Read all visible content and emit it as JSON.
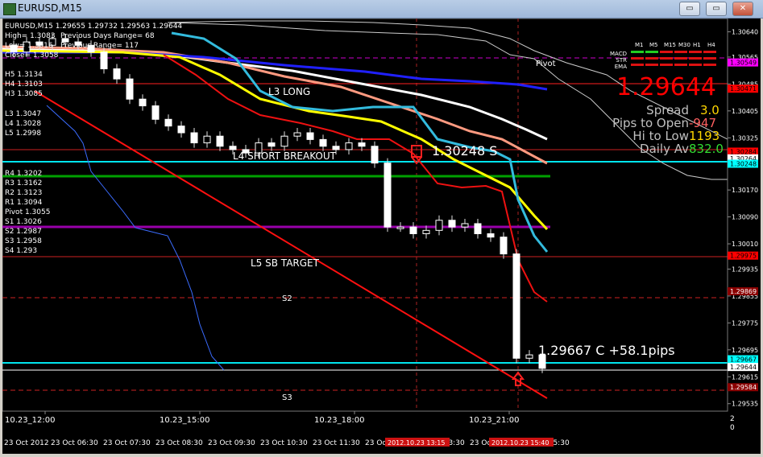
{
  "window": {
    "title": "EURUSD,M15",
    "buttons": {
      "minimize": "▭",
      "restore": "▭",
      "close": "✕"
    }
  },
  "header": {
    "ohlc": "EURUSD,M15  1.29655 1.29732 1.29563 1.29644",
    "high": "High= 1.3083",
    "low": "Low= 1.3016",
    "close": "Close= 1.3058",
    "prev_range": "Previous Days Range= 68",
    "prev_range2": "Previous Range= 117"
  },
  "levels_left_top": [
    "H5 1.3134",
    "H4 1.3103",
    "H3 1.3085"
  ],
  "levels_left_mid": [
    "L3 1.3047",
    "L4 1.3028",
    "L5 1.2998"
  ],
  "levels_left_bottom": [
    "R4 1.3202",
    "R3 1.3162",
    "R2 1.3123",
    "R1 1.3094",
    "Pivot 1.3055",
    "S1 1.3026",
    "S2 1.2987",
    "S3 1.2958",
    "S4 1.293"
  ],
  "chart_labels": {
    "l3_long": "L3 LONG",
    "l4_short": "L4 SHORT BREAKOUT",
    "l5_target": "L5 SB TARGET",
    "s2": "S2",
    "s3": "S3",
    "pivot": "Pivot",
    "signal": "1.30248 S",
    "close_result": "1.29667 C +58.1pips"
  },
  "info": {
    "price": "1.29644",
    "spread_label": "Spread",
    "spread_value": "3.0",
    "pips_open_label": "Pips to Open",
    "pips_open_value": "-947",
    "hilo_label": "Hi to Low",
    "hilo_value": "1193",
    "daily_label": "Daily Av",
    "daily_value": "832.0"
  },
  "mini_panel": {
    "tf_labels": [
      "M1",
      "M5",
      "M15",
      "M30",
      "H1",
      "H4"
    ],
    "rows": [
      "MACD",
      "STR",
      "EMA"
    ]
  },
  "price_axis": {
    "ticks": [
      "1.30640",
      "1.30565",
      "1.30485",
      "1.30405",
      "1.30325",
      "1.30250",
      "1.30170",
      "1.30090",
      "1.30010",
      "1.29935",
      "1.29855",
      "1.29775",
      "1.29695",
      "1.29615",
      "1.29535"
    ],
    "markers": [
      {
        "value": "1.30549",
        "color": "#ff00ff",
        "text": "#000000"
      },
      {
        "value": "1.30471",
        "color": "#ff0000",
        "text": "#000000"
      },
      {
        "value": "1.30284",
        "color": "#ff0000",
        "text": "#000000"
      },
      {
        "value": "1.30264",
        "color": "#ffffff",
        "text": "#000000"
      },
      {
        "value": "1.30248",
        "color": "#00ffff",
        "text": "#000000"
      },
      {
        "value": "1.29975",
        "color": "#ff0000",
        "text": "#000000"
      },
      {
        "value": "1.29869",
        "color": "#8b0000",
        "text": "#ffffff"
      },
      {
        "value": "1.29667",
        "color": "#00ffff",
        "text": "#000000"
      },
      {
        "value": "1.29644",
        "color": "#ffffff",
        "text": "#000000"
      },
      {
        "value": "1.29584",
        "color": "#8b0000",
        "text": "#ffffff"
      }
    ]
  },
  "time_axis_upper": [
    "10.23_12:00",
    "10.23_15:00",
    "10.23_18:00",
    "10.23_21:00"
  ],
  "time_axis_lower": [
    "23 Oct 2012",
    "23 Oct 06:30",
    "23 Oct 07:30",
    "23 Oct 08:30",
    "23 Oct 09:30",
    "23 Oct 10:30",
    "23 Oct 11:30",
    "23 Oct 12:30",
    "23 Oct 13:30",
    "23 Oct 14:30",
    "23 Oct 15:30"
  ],
  "time_markers": [
    "2012.10.23 13:15",
    "2012.10.23 15:40"
  ],
  "bottom_right": [
    "2",
    "0"
  ],
  "chart_data": {
    "type": "line",
    "title": "EURUSD,M15",
    "ylim": [
      1.2952,
      1.3067
    ],
    "grid": false,
    "candles_close": [
      1.3058,
      1.3061,
      1.306,
      1.3062,
      1.3061,
      1.306,
      1.3058,
      1.3053,
      1.305,
      1.3044,
      1.3042,
      1.3038,
      1.3036,
      1.3034,
      1.3031,
      1.3033,
      1.303,
      1.3029,
      1.3028,
      1.3031,
      1.303,
      1.3033,
      1.3034,
      1.3032,
      1.303,
      1.3029,
      1.3031,
      1.303,
      1.3025,
      1.3006,
      1.3006,
      1.3004,
      1.3005,
      1.3008,
      1.3006,
      1.3007,
      1.3004,
      1.3003,
      1.2998,
      1.2967,
      1.2968,
      1.2964
    ]
  }
}
